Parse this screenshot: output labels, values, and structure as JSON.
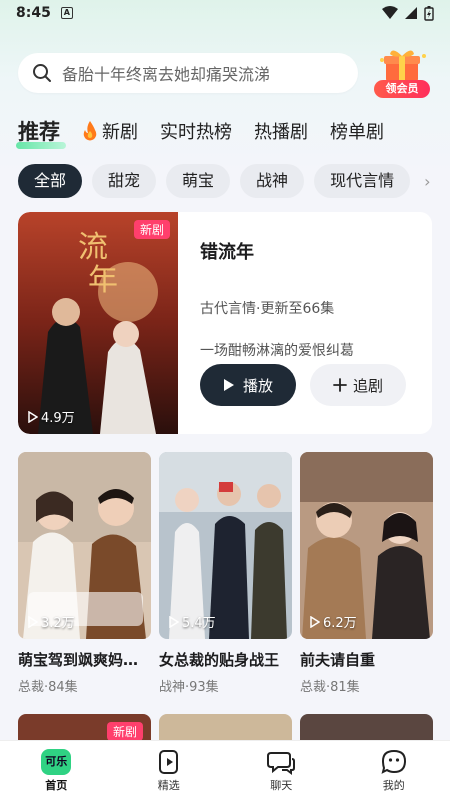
{
  "status": {
    "time": "8:45"
  },
  "search": {
    "placeholder": "备胎十年终离去她却痛哭流涕",
    "vip_label": "领会员"
  },
  "tabs": [
    {
      "label": "推荐",
      "active": true
    },
    {
      "label": "新剧",
      "icon": "fire-icon"
    },
    {
      "label": "实时热榜"
    },
    {
      "label": "热播剧"
    },
    {
      "label": "榜单剧"
    }
  ],
  "chips": [
    "全部",
    "甜宠",
    "萌宝",
    "战神",
    "现代言情"
  ],
  "featured": {
    "title": "错流年",
    "meta": "古代言情·更新至66集",
    "desc": "一场酣畅淋漓的爱恨纠葛",
    "badge": "新剧",
    "plays": "4.9万",
    "play_label": "播放",
    "follow_label": "追剧"
  },
  "cards": [
    {
      "name": "萌宝驾到飒爽妈…",
      "sub": "总裁·84集",
      "plays": "3.2万"
    },
    {
      "name": "女总裁的贴身战王",
      "sub": "战神·93集",
      "plays": "5.4万"
    },
    {
      "name": "前夫请自重",
      "sub": "总裁·81集",
      "plays": "6.2万"
    }
  ],
  "cards2_badge": "新剧",
  "nav": [
    {
      "label": "首页",
      "icon": "home-logo-icon",
      "active": true
    },
    {
      "label": "精选",
      "icon": "play-doc-icon"
    },
    {
      "label": "聊天",
      "icon": "chat-icon"
    },
    {
      "label": "我的",
      "icon": "profile-icon"
    }
  ],
  "colors": {
    "accent_dark": "#1f2a36",
    "new_badge": "#ff3f6c",
    "brand_green": "#2fd283"
  }
}
